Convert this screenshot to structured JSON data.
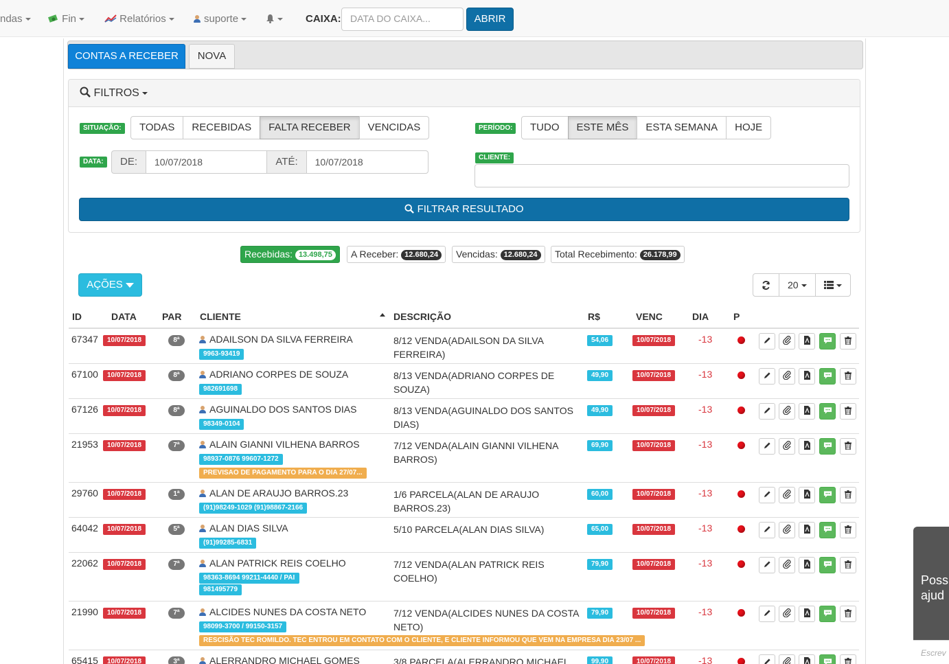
{
  "nav": {
    "vendas": "ndas",
    "fin": "Fin",
    "relatorios": "Relatórios",
    "suporte": "suporte",
    "caixa_label": "CAIXA:",
    "caixa_placeholder": "DATA DO CAIXA...",
    "abrir": "ABRIR"
  },
  "tabs": [
    {
      "label": "CONTAS A RECEBER",
      "active": true
    },
    {
      "label": "NOVA",
      "active": false
    }
  ],
  "filters": {
    "title": "FILTROS",
    "situacao_label": "SITUAÇÃO:",
    "situacao_options": [
      "TODAS",
      "RECEBIDAS",
      "FALTA RECEBER",
      "VENCIDAS"
    ],
    "situacao_selected": "FALTA RECEBER",
    "periodo_label": "PERÍODO:",
    "periodo_options": [
      "TUDO",
      "ESTE MÊS",
      "ESTA SEMANA",
      "HOJE"
    ],
    "periodo_selected": "ESTE MÊS",
    "data_label": "DATA:",
    "de_label": "DE:",
    "de_value": "10/07/2018",
    "ate_label": "ATÉ:",
    "ate_value": "10/07/2018",
    "cliente_label": "CLIENTE:",
    "cliente_value": "",
    "filtrar": "FILTRAR RESULTADO"
  },
  "summary": {
    "recebidas_label": "Recebidas:",
    "recebidas_value": "13.498,75",
    "a_receber_label": "A Receber:",
    "a_receber_value": "12.680,24",
    "vencidas_label": "Vencidas:",
    "vencidas_value": "12.680,24",
    "total_label": "Total Recebimento:",
    "total_value": "26.178,99"
  },
  "toolbar": {
    "acoes": "AÇÕES",
    "page_size": "20"
  },
  "table": {
    "headers": [
      "ID",
      "DATA",
      "PAR",
      "CLIENTE",
      "DESCRIÇÃO",
      "R$",
      "VENC",
      "DIA",
      "P"
    ],
    "rows": [
      {
        "id": "67347",
        "data": "10/07/2018",
        "par": "8ª",
        "cliente": "ADAILSON DA SILVA FERREIRA",
        "phone": "9963-93419",
        "phone2": "",
        "note": "",
        "desc1": "8/12 VENDA(ADAILSON DA SILVA",
        "desc2": "FERREIRA)",
        "valor": "54,06",
        "venc": "10/07/2018",
        "dia": "-13"
      },
      {
        "id": "67100",
        "data": "10/07/2018",
        "par": "8ª",
        "cliente": "ADRIANO CORPES DE SOUZA",
        "phone": "982691698",
        "phone2": "",
        "note": "",
        "desc1": "8/13 VENDA(ADRIANO CORPES DE",
        "desc2": "SOUZA)",
        "valor": "49,90",
        "venc": "10/07/2018",
        "dia": "-13"
      },
      {
        "id": "67126",
        "data": "10/07/2018",
        "par": "8ª",
        "cliente": "AGUINALDO DOS SANTOS DIAS",
        "phone": "98349-0104",
        "phone2": "",
        "note": "",
        "desc1": "8/13 VENDA(AGUINALDO DOS SANTOS",
        "desc2": "DIAS)",
        "valor": "49,90",
        "venc": "10/07/2018",
        "dia": "-13"
      },
      {
        "id": "21953",
        "data": "10/07/2018",
        "par": "7ª",
        "cliente": "ALAIN GIANNI VILHENA BARROS",
        "phone": "98937-0876 99607-1272",
        "phone2": "",
        "note": "PREVISAO DE PAGAMENTO PARA O DIA 27/07...",
        "desc1": "7/12 VENDA(ALAIN GIANNI VILHENA",
        "desc2": "BARROS)",
        "valor": "69,90",
        "venc": "10/07/2018",
        "dia": "-13"
      },
      {
        "id": "29760",
        "data": "10/07/2018",
        "par": "1ª",
        "cliente": "ALAN DE ARAUJO BARROS.23",
        "phone": "(91)98249-1029 (91)98867-2166",
        "phone2": "",
        "note": "",
        "desc1": "1/6 PARCELA(ALAN DE ARAUJO",
        "desc2": "BARROS.23)",
        "valor": "60,00",
        "venc": "10/07/2018",
        "dia": "-13"
      },
      {
        "id": "64042",
        "data": "10/07/2018",
        "par": "5ª",
        "cliente": "ALAN DIAS SILVA",
        "phone": "(91)99285-6831",
        "phone2": "",
        "note": "",
        "desc1": "5/10 PARCELA(ALAN DIAS SILVA)",
        "desc2": "",
        "valor": "65,00",
        "venc": "10/07/2018",
        "dia": "-13"
      },
      {
        "id": "22062",
        "data": "10/07/2018",
        "par": "7ª",
        "cliente": "ALAN PATRICK REIS COELHO",
        "phone": "98363-8694 99211-4440 / PAI",
        "phone2": "981495779",
        "note": "",
        "desc1": "7/12 VENDA(ALAN PATRICK REIS",
        "desc2": "COELHO)",
        "valor": "79,90",
        "venc": "10/07/2018",
        "dia": "-13"
      },
      {
        "id": "21990",
        "data": "10/07/2018",
        "par": "7ª",
        "cliente": "ALCIDES NUNES DA COSTA NETO",
        "phone": "98099-3700 / 99150-3157",
        "phone2": "",
        "note": "RESCISÃO TEC ROMILDO. TEC ENTROU EM CONTATO COM O CLIENTE, E CLIENTE INFORMOU QUE VEM NA EMPRESA DIA 23/07 ...",
        "desc1": "7/12 VENDA(ALCIDES NUNES DA COSTA",
        "desc2": "NETO)",
        "valor": "79,90",
        "venc": "10/07/2018",
        "dia": "-13"
      },
      {
        "id": "65415",
        "data": "10/07/2018",
        "par": "3ª",
        "cliente": "ALERRANDRO MICHAEL GOMES",
        "phone": "",
        "phone2": "",
        "note": "",
        "desc1": "3/8 PARCELA(ALERRANDRO MICHAEL",
        "desc2": "",
        "valor": "99,90",
        "venc": "10/07/2018",
        "dia": "-13"
      }
    ]
  },
  "chat": {
    "line1": "Poss",
    "line2": "ajud",
    "input_placeholder": "Escrev"
  },
  "colors": {
    "primary": "#0f6fa6",
    "tab_active": "#0f82d8",
    "success": "#2fa54b",
    "danger": "#d9363e",
    "info": "#2bbcdf",
    "warning": "#f0ad4e"
  }
}
